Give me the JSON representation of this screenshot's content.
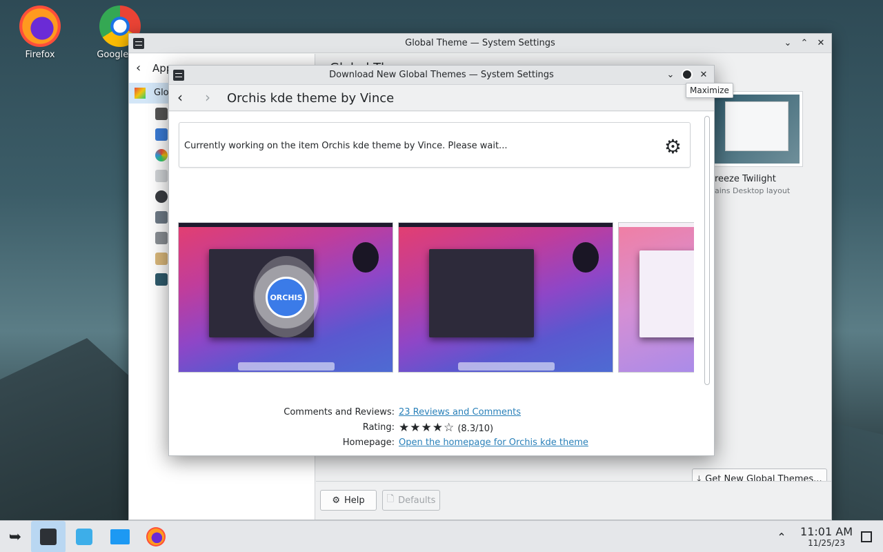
{
  "desktop": {
    "icons": [
      {
        "label": "Firefox"
      },
      {
        "label": "Google Ch"
      }
    ]
  },
  "main_window": {
    "title": "Global Theme — System Settings",
    "sidebar_header": "App",
    "sidebar_selected": "Glob",
    "heading": "Global Th",
    "theme_card": {
      "name": "reeze Twilight",
      "subtitle": "ains Desktop layout"
    },
    "get_new_button": "Get New Global Themes...",
    "help_button": "Help",
    "defaults_button": "Defaults"
  },
  "dialog": {
    "title": "Download New Global Themes — System Settings",
    "page_title": "Orchis kde theme by Vince",
    "status_text": "Currently working on the item Orchis kde theme by Vince. Please wait...",
    "screenshot_badge": "ORCHIS",
    "details": {
      "comments_label": "Comments and Reviews:",
      "comments_value": "23 Reviews and Comments",
      "rating_label": "Rating:",
      "rating_stars": 4,
      "rating_text": "(8.3/10)",
      "homepage_label": "Homepage:",
      "homepage_value": "Open the homepage for Orchis kde theme"
    },
    "tooltip": "Maximize"
  },
  "taskbar": {
    "time": "11:01 AM",
    "date": "11/25/23"
  },
  "colors": {
    "accent": "#3daee9",
    "link": "#2980b9",
    "selection": "#d3e6f7"
  }
}
